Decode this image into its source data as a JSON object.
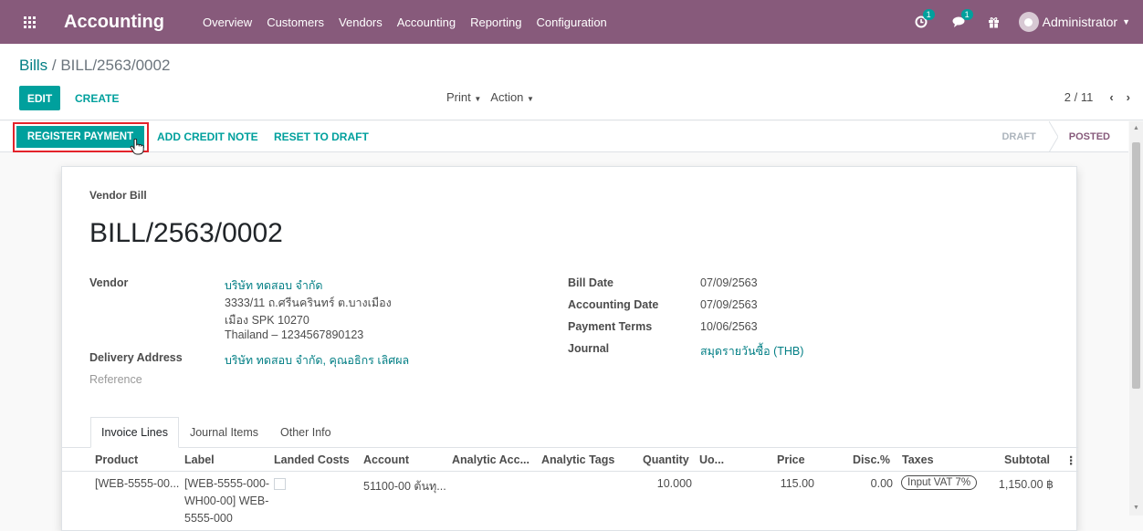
{
  "app": {
    "name": "Accounting"
  },
  "top_menu": [
    "Overview",
    "Customers",
    "Vendors",
    "Accounting",
    "Reporting",
    "Configuration"
  ],
  "systray": {
    "activity_count": "1",
    "messages_count": "1",
    "user_name": "Administrator"
  },
  "breadcrumb": {
    "parent": "Bills",
    "separator": " / ",
    "current": "BILL/2563/0002"
  },
  "control": {
    "edit_label": "EDIT",
    "create_label": "CREATE",
    "print_label": "Print",
    "action_label": "Action",
    "pager_value": "2 / 11"
  },
  "statusbar": {
    "register_payment": "REGISTER PAYMENT",
    "add_credit_note": "ADD CREDIT NOTE",
    "reset_to_draft": "RESET TO DRAFT",
    "stages": [
      "DRAFT",
      "POSTED"
    ],
    "active_stage": "POSTED"
  },
  "bill": {
    "type": "Vendor Bill",
    "name": "BILL/2563/0002",
    "vendor_label": "Vendor",
    "vendor_name": "บริษัท ทดสอบ จำกัด",
    "vendor_address": [
      "3333/11 ถ.ศรีนครินทร์ ต.บางเมือง",
      "เมือง SPK 10270",
      "Thailand – 1234567890123"
    ],
    "delivery_label": "Delivery Address",
    "delivery_value": "บริษัท ทดสอบ จำกัด, คุณอธิกร เลิศผล",
    "reference_placeholder": "Reference",
    "bill_date_label": "Bill Date",
    "bill_date": "07/09/2563",
    "accounting_date_label": "Accounting Date",
    "accounting_date": "07/09/2563",
    "payment_terms_label": "Payment Terms",
    "payment_terms": "10/06/2563",
    "journal_label": "Journal",
    "journal": "สมุดรายวันซื้อ (THB)"
  },
  "tabs": [
    "Invoice Lines",
    "Journal Items",
    "Other Info"
  ],
  "table": {
    "columns": [
      "Product",
      "Label",
      "Landed Costs",
      "Account",
      "Analytic Acc...",
      "Analytic Tags",
      "Quantity",
      "Uo...",
      "Price",
      "Disc.%",
      "Taxes",
      "Subtotal"
    ],
    "rows": [
      {
        "product": "[WEB-5555-00...",
        "label_lines": [
          "[WEB-5555-000-",
          "WH00-00] WEB-",
          "5555-000"
        ],
        "account": "51100-00 ต้นทุ...",
        "quantity": "10.000",
        "price": "115.00",
        "disc": "0.00",
        "tax": "Input VAT 7%",
        "subtotal": "1,150.00 ฿"
      }
    ]
  },
  "colors": {
    "brand": "#875a7b",
    "primary": "#00a09d",
    "link": "#017e84",
    "highlight": "#e3232b"
  }
}
